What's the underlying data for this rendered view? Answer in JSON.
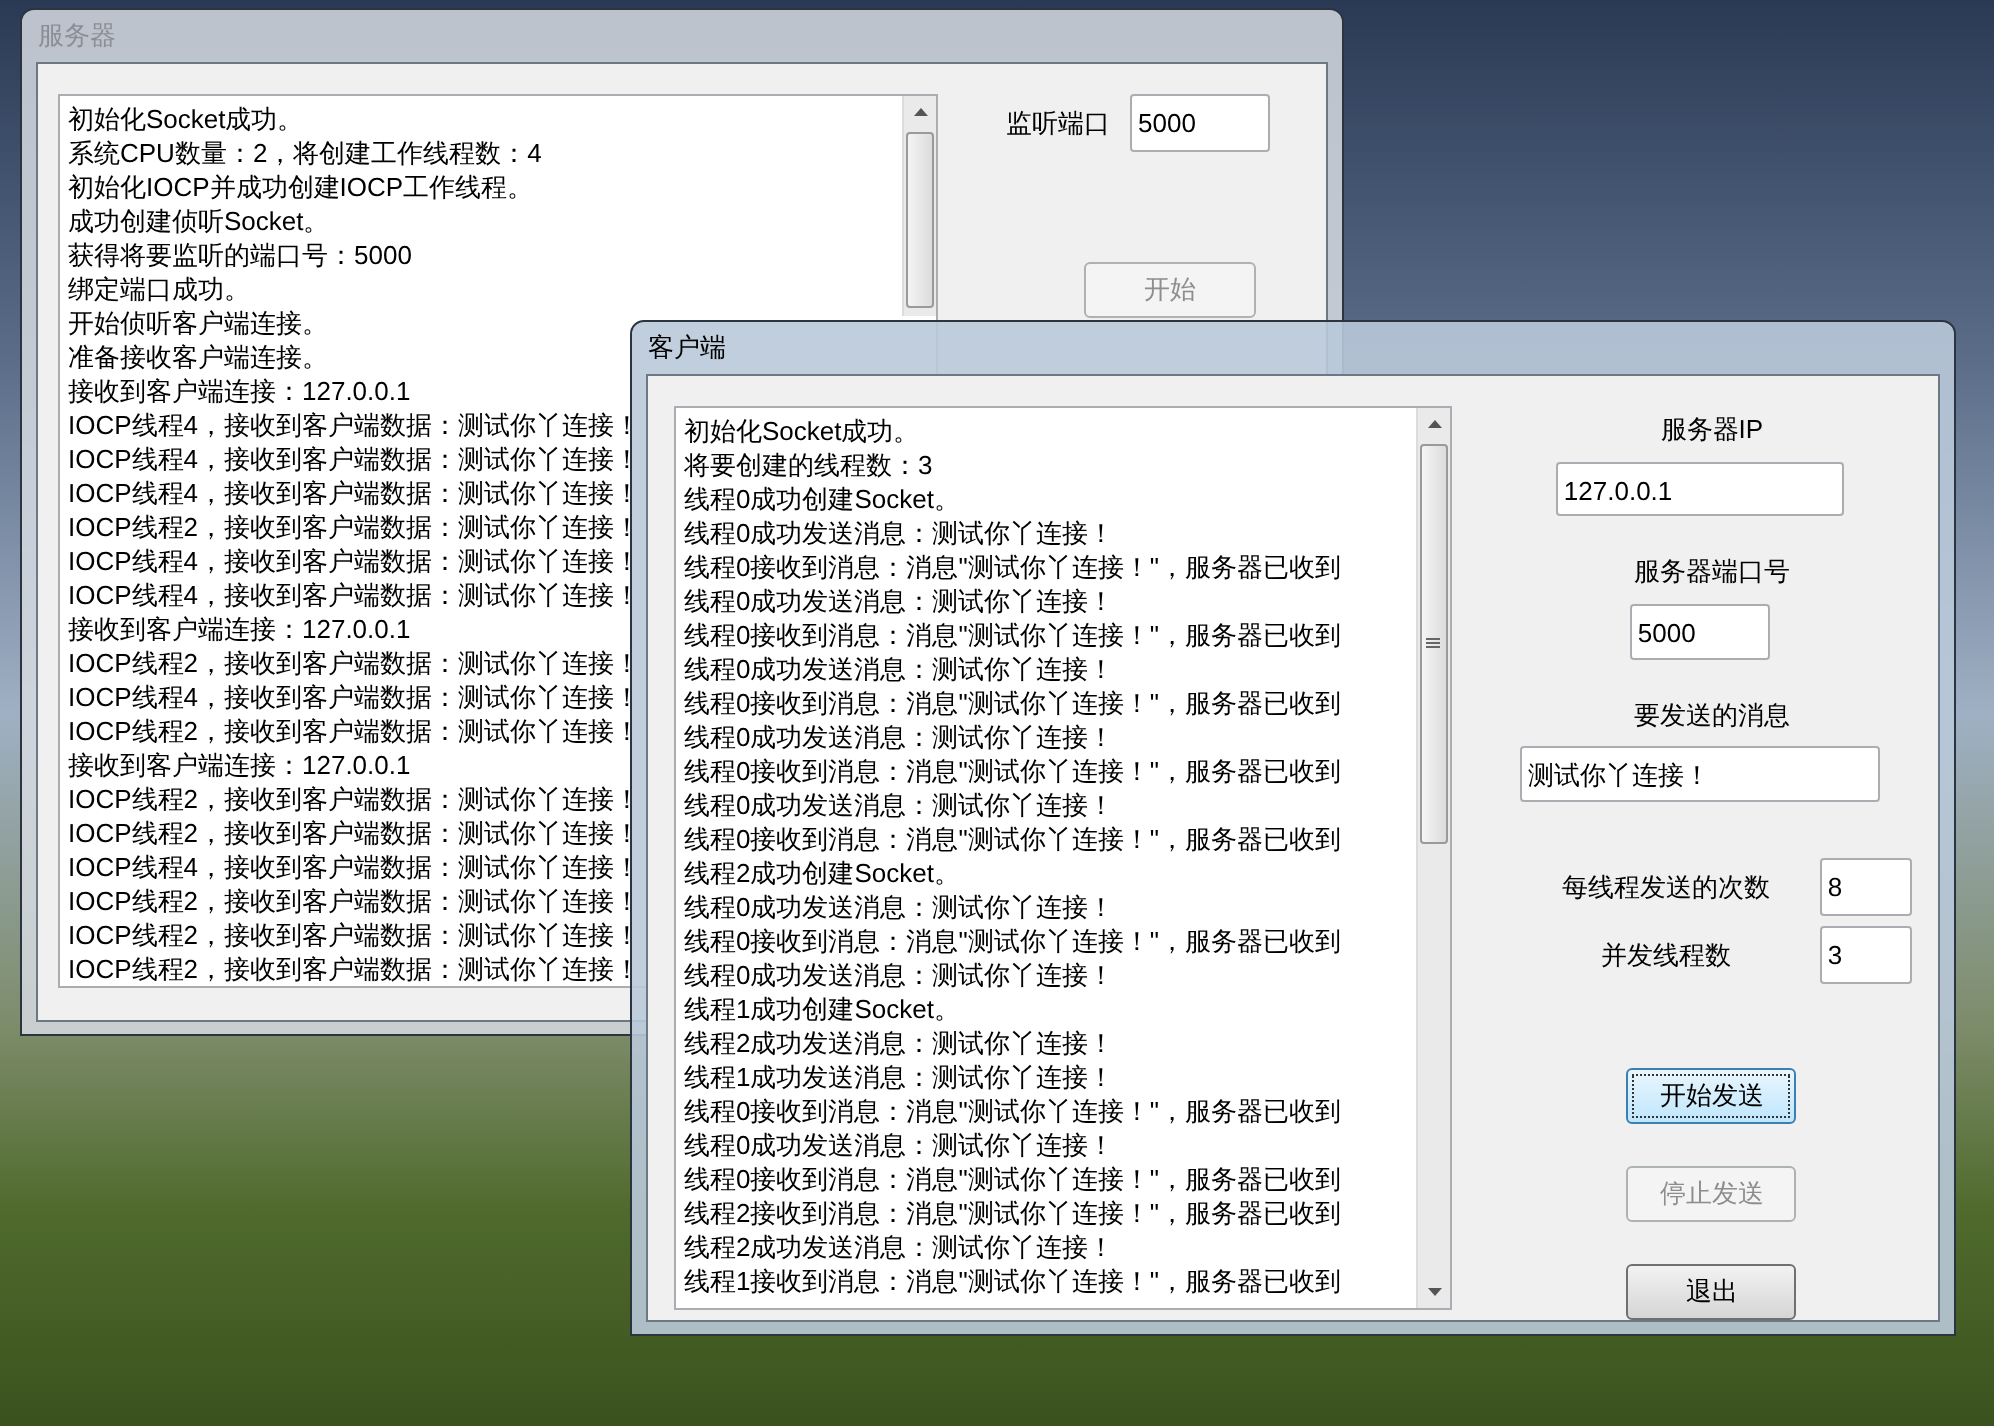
{
  "server_window": {
    "title": "服务器",
    "active": false,
    "log_lines": [
      "初始化Socket成功。",
      "系统CPU数量：2，将创建工作线程数：4",
      "初始化IOCP并成功创建IOCP工作线程。",
      "成功创建侦听Socket。",
      "获得将要监听的端口号：5000",
      "绑定端口成功。",
      "开始侦听客户端连接。",
      "准备接收客户端连接。",
      "接收到客户端连接：127.0.0.1",
      "IOCP线程4，接收到客户端数据：测试你丫连接！",
      "IOCP线程4，接收到客户端数据：测试你丫连接！",
      "IOCP线程4，接收到客户端数据：测试你丫连接！",
      "IOCP线程2，接收到客户端数据：测试你丫连接！",
      "IOCP线程4，接收到客户端数据：测试你丫连接！",
      "IOCP线程4，接收到客户端数据：测试你丫连接！",
      "接收到客户端连接：127.0.0.1",
      "IOCP线程2，接收到客户端数据：测试你丫连接！",
      "IOCP线程4，接收到客户端数据：测试你丫连接！",
      "IOCP线程2，接收到客户端数据：测试你丫连接！",
      "接收到客户端连接：127.0.0.1",
      "IOCP线程2，接收到客户端数据：测试你丫连接！",
      "IOCP线程2，接收到客户端数据：测试你丫连接！",
      "IOCP线程4，接收到客户端数据：测试你丫连接！",
      "IOCP线程2，接收到客户端数据：测试你丫连接！",
      "IOCP线程2，接收到客户端数据：测试你丫连接！",
      "IOCP线程2，接收到客户端数据：测试你丫连接！"
    ],
    "port_label": "监听端口",
    "port_value": "5000",
    "start_button": {
      "label": "开始",
      "disabled": true
    }
  },
  "client_window": {
    "title": "客户端",
    "active": true,
    "log_lines": [
      "初始化Socket成功。",
      "将要创建的线程数：3",
      "线程0成功创建Socket。",
      "线程0成功发送消息：测试你丫连接！",
      "线程0接收到消息：消息\"测试你丫连接！\"，服务器已收到",
      "线程0成功发送消息：测试你丫连接！",
      "线程0接收到消息：消息\"测试你丫连接！\"，服务器已收到",
      "线程0成功发送消息：测试你丫连接！",
      "线程0接收到消息：消息\"测试你丫连接！\"，服务器已收到",
      "线程0成功发送消息：测试你丫连接！",
      "线程0接收到消息：消息\"测试你丫连接！\"，服务器已收到",
      "线程0成功发送消息：测试你丫连接！",
      "线程0接收到消息：消息\"测试你丫连接！\"，服务器已收到",
      "线程2成功创建Socket。",
      "线程0成功发送消息：测试你丫连接！",
      "线程0接收到消息：消息\"测试你丫连接！\"，服务器已收到",
      "线程0成功发送消息：测试你丫连接！",
      "线程1成功创建Socket。",
      "线程2成功发送消息：测试你丫连接！",
      "线程1成功发送消息：测试你丫连接！",
      "线程0接收到消息：消息\"测试你丫连接！\"，服务器已收到",
      "线程0成功发送消息：测试你丫连接！",
      "线程0接收到消息：消息\"测试你丫连接！\"，服务器已收到",
      "线程2接收到消息：消息\"测试你丫连接！\"，服务器已收到",
      "线程2成功发送消息：测试你丫连接！",
      "线程1接收到消息：消息\"测试你丫连接！\"，服务器已收到"
    ],
    "fields": [
      {
        "kind": "stacked",
        "label": "服务器IP",
        "value": "127.0.0.1"
      },
      {
        "kind": "stacked",
        "label": "服务器端口号",
        "value": "5000"
      },
      {
        "kind": "stacked",
        "label": "要发送的消息",
        "value": "测试你丫连接！"
      },
      {
        "kind": "inline",
        "label": "每线程发送的次数",
        "value": "8"
      },
      {
        "kind": "inline",
        "label": "并发线程数",
        "value": "3"
      }
    ],
    "buttons": [
      {
        "label": "开始发送",
        "focused": true,
        "disabled": false
      },
      {
        "label": "停止发送",
        "focused": false,
        "disabled": true
      },
      {
        "label": "退出",
        "focused": false,
        "disabled": false
      }
    ]
  }
}
